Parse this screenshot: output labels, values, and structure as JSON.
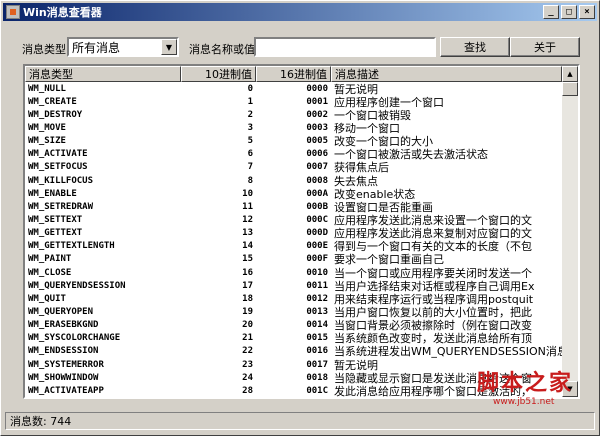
{
  "window": {
    "title": "Win消息查看器",
    "min_glyph": "_",
    "max_glyph": "□",
    "close_glyph": "×"
  },
  "toolbar": {
    "type_label": "消息类型:",
    "type_value": "所有消息",
    "name_label": "消息名称或值:",
    "name_value": "",
    "search_label": "查找",
    "about_label": "关于"
  },
  "table": {
    "columns": [
      "消息类型",
      "10进制值",
      "16进制值",
      "消息描述"
    ],
    "rows": [
      [
        "WM_NULL",
        "0",
        "0000",
        "暂无说明"
      ],
      [
        "WM_CREATE",
        "1",
        "0001",
        "应用程序创建一个窗口"
      ],
      [
        "WM_DESTROY",
        "2",
        "0002",
        "一个窗口被销毁"
      ],
      [
        "WM_MOVE",
        "3",
        "0003",
        "移动一个窗口"
      ],
      [
        "WM_SIZE",
        "5",
        "0005",
        "改变一个窗口的大小"
      ],
      [
        "WM_ACTIVATE",
        "6",
        "0006",
        "一个窗口被激活或失去激活状态"
      ],
      [
        "WM_SETFOCUS",
        "7",
        "0007",
        "获得焦点后"
      ],
      [
        "WM_KILLFOCUS",
        "8",
        "0008",
        "失去焦点"
      ],
      [
        "WM_ENABLE",
        "10",
        "000A",
        "改变enable状态"
      ],
      [
        "WM_SETREDRAW",
        "11",
        "000B",
        "设置窗口是否能重画"
      ],
      [
        "WM_SETTEXT",
        "12",
        "000C",
        "应用程序发送此消息来设置一个窗口的文"
      ],
      [
        "WM_GETTEXT",
        "13",
        "000D",
        "应用程序发送此消息来复制对应窗口的文"
      ],
      [
        "WM_GETTEXTLENGTH",
        "14",
        "000E",
        "得到与一个窗口有关的文本的长度（不包"
      ],
      [
        "WM_PAINT",
        "15",
        "000F",
        "要求一个窗口重画自己"
      ],
      [
        "WM_CLOSE",
        "16",
        "0010",
        "当一个窗口或应用程序要关闭时发送一个"
      ],
      [
        "WM_QUERYENDSESSION",
        "17",
        "0011",
        "当用户选择结束对话框或程序自己调用Ex"
      ],
      [
        "WM_QUIT",
        "18",
        "0012",
        "用来结束程序运行或当程序调用postquit"
      ],
      [
        "WM_QUERYOPEN",
        "19",
        "0013",
        "当用户窗口恢复以前的大小位置时，把此"
      ],
      [
        "WM_ERASEBKGND",
        "20",
        "0014",
        "当窗口背景必须被擦除时（例在窗口改变"
      ],
      [
        "WM_SYSCOLORCHANGE",
        "21",
        "0015",
        "当系统颜色改变时，发送此消息给所有顶"
      ],
      [
        "WM_ENDSESSION",
        "22",
        "0016",
        "当系统进程发出WM_QUERYENDSESSION消息"
      ],
      [
        "WM_SYSTEMERROR",
        "23",
        "0017",
        "暂无说明"
      ],
      [
        "WM_SHOWWINDOW",
        "24",
        "0018",
        "当隐藏或显示窗口是发送此消息给这个窗"
      ],
      [
        "WM_ACTIVATEAPP",
        "28",
        "001C",
        "发此消息给应用程序哪个窗口是激活的，"
      ]
    ]
  },
  "status": {
    "text": "消息数: 744"
  },
  "watermark": {
    "logo_text": "脚本之家",
    "url_text": "www.jb51.net"
  },
  "colors": {
    "titlebar_start": "#0a246a",
    "titlebar_end": "#a6caf0",
    "face": "#d4d0c8",
    "watermark": "#c81c1c"
  }
}
